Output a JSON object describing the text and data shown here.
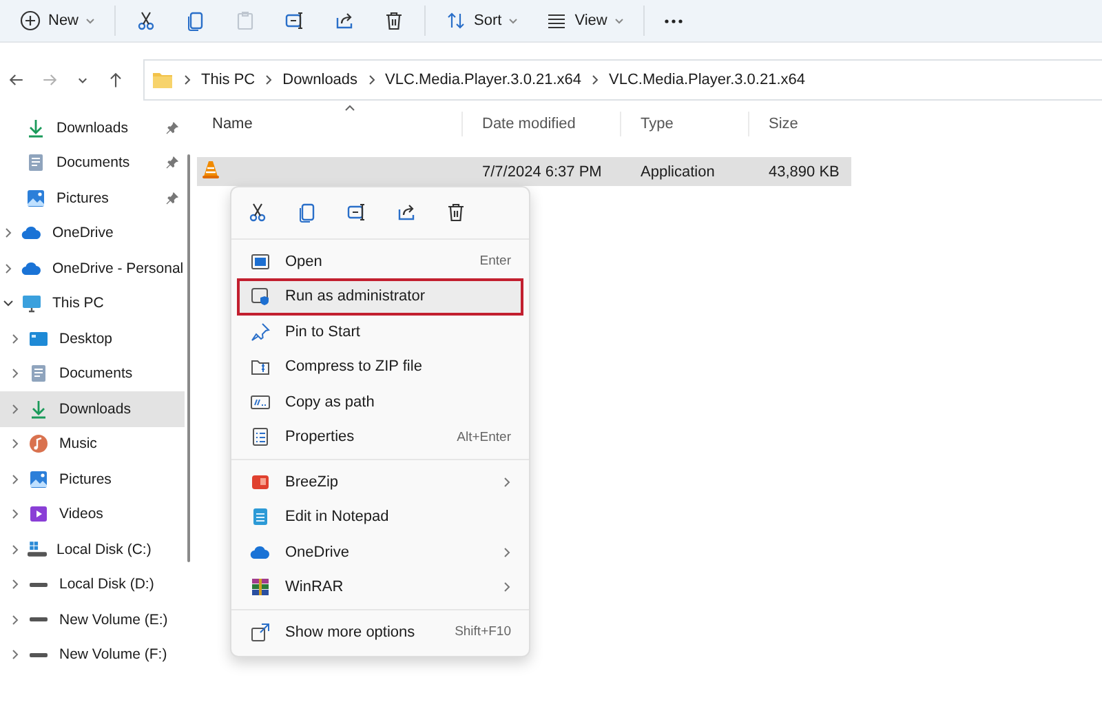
{
  "toolbar": [
    {
      "kind": "new",
      "label": "New",
      "disabled": false
    },
    {
      "kind": "cut",
      "disabled": false
    },
    {
      "kind": "copy",
      "disabled": false
    },
    {
      "kind": "paste",
      "disabled": true
    },
    {
      "kind": "rename",
      "disabled": false
    },
    {
      "kind": "share",
      "disabled": false
    },
    {
      "kind": "delete",
      "disabled": false
    },
    {
      "kind": "sort",
      "label": "Sort",
      "disabled": false
    },
    {
      "kind": "view",
      "label": "View",
      "disabled": false
    },
    {
      "kind": "more",
      "disabled": false
    }
  ],
  "navigation": {
    "back_disabled": false,
    "forward_disabled": true
  },
  "breadcrumb": [
    "This PC",
    "Downloads",
    "VLC.Media.Player.3.0.21.x64",
    "VLC.Media.Player.3.0.21.x64"
  ],
  "sidebar": {
    "items": [
      {
        "label": "Downloads",
        "kind": "downloads",
        "pinned": true,
        "selected": false
      },
      {
        "label": "Documents",
        "kind": "documents",
        "pinned": true,
        "selected": false
      },
      {
        "label": "Pictures",
        "kind": "pictures",
        "pinned": true,
        "selected": false
      },
      {
        "label": "OneDrive",
        "kind": "cloud",
        "expanded": false,
        "selected": false
      },
      {
        "label": "OneDrive - Personal",
        "kind": "cloud",
        "expanded": false,
        "selected": false
      },
      {
        "label": "This PC",
        "kind": "pc",
        "expanded": true,
        "selected": false,
        "children": [
          {
            "label": "Desktop",
            "kind": "desktop",
            "expanded": false,
            "selected": false
          },
          {
            "label": "Documents",
            "kind": "documents",
            "expanded": false,
            "selected": false
          },
          {
            "label": "Downloads",
            "kind": "downloads",
            "expanded": false,
            "selected": true
          },
          {
            "label": "Music",
            "kind": "music",
            "expanded": false,
            "selected": false
          },
          {
            "label": "Pictures",
            "kind": "pictures",
            "expanded": false,
            "selected": false
          },
          {
            "label": "Videos",
            "kind": "videos",
            "expanded": false,
            "selected": false
          },
          {
            "label": "Local Disk (C:)",
            "kind": "systemdisk",
            "expanded": false,
            "selected": false
          },
          {
            "label": "Local Disk (D:)",
            "kind": "disk",
            "expanded": false,
            "selected": false
          },
          {
            "label": "New Volume (E:)",
            "kind": "disk",
            "expanded": false,
            "selected": false
          },
          {
            "label": "New Volume (F:)",
            "kind": "disk",
            "expanded": false,
            "selected": false
          }
        ]
      }
    ]
  },
  "table": {
    "columns": [
      {
        "label": "Name",
        "sorted": true
      },
      {
        "label": "Date modified",
        "sorted": false
      },
      {
        "label": "Type",
        "sorted": false
      },
      {
        "label": "Size",
        "sorted": false
      }
    ],
    "rows": [
      {
        "kind": "vlc",
        "date": "7/7/2024 6:37 PM",
        "type": "Application",
        "size": "43,890 KB",
        "selected": true
      }
    ]
  },
  "context_menu": {
    "quick_actions": [
      {
        "kind": "cut"
      },
      {
        "kind": "copy"
      },
      {
        "kind": "rename"
      },
      {
        "kind": "share"
      },
      {
        "kind": "delete"
      }
    ],
    "sections": [
      [
        {
          "kind": "open",
          "label": "Open",
          "shortcut": "Enter",
          "highlighted": false
        },
        {
          "kind": "admin",
          "label": "Run as administrator",
          "highlighted": true
        },
        {
          "kind": "pin",
          "label": "Pin to Start",
          "highlighted": false
        },
        {
          "kind": "zip",
          "label": "Compress to ZIP file",
          "highlighted": false
        },
        {
          "kind": "path",
          "label": "Copy as path",
          "highlighted": false
        },
        {
          "kind": "properties",
          "label": "Properties",
          "shortcut": "Alt+Enter",
          "highlighted": false
        }
      ],
      [
        {
          "kind": "breezip",
          "label": "BreeZip",
          "submenu": true,
          "highlighted": false
        },
        {
          "kind": "notepad",
          "label": "Edit in Notepad",
          "submenu": false,
          "highlighted": false
        },
        {
          "kind": "cloud",
          "label": "OneDrive",
          "submenu": true,
          "highlighted": false
        },
        {
          "kind": "winrar",
          "label": "WinRAR",
          "submenu": true,
          "highlighted": false
        }
      ],
      [
        {
          "kind": "more",
          "label": "Show more options",
          "shortcut": "Shift+F10",
          "highlighted": false
        }
      ]
    ]
  }
}
